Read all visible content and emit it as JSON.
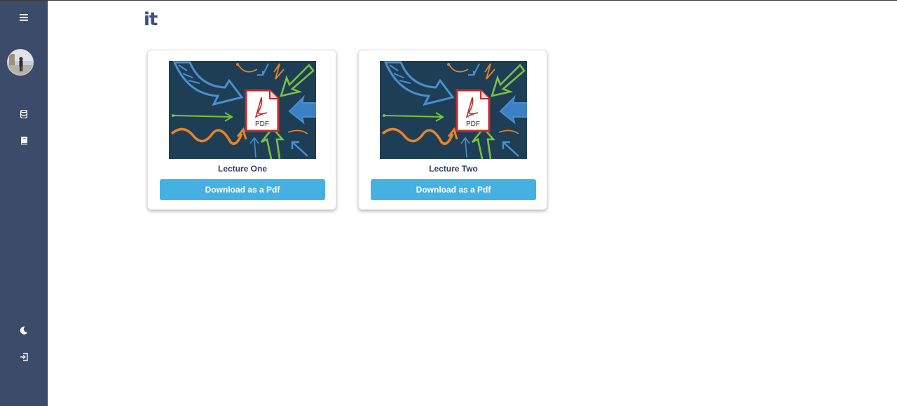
{
  "header": {
    "title": "it"
  },
  "sidebar": {
    "items": [
      {
        "icon": "hamburger-menu-icon"
      },
      {
        "icon": "avatar"
      },
      {
        "icon": "database-icon"
      },
      {
        "icon": "book-icon"
      },
      {
        "icon": "moon-icon"
      },
      {
        "icon": "logout-icon"
      }
    ],
    "colors": {
      "background": "#3d4b6b",
      "icon": "#ffffff"
    }
  },
  "cards": [
    {
      "title": "Lecture One",
      "thumbnail_label": "PDF",
      "button_label": "Download as a Pdf"
    },
    {
      "title": "Lecture Two",
      "thumbnail_label": "PDF",
      "button_label": "Download as a Pdf"
    }
  ],
  "theme": {
    "accent": "#45b1e2",
    "title_color": "#3b4e82",
    "card_title_color": "#2d3d63"
  }
}
